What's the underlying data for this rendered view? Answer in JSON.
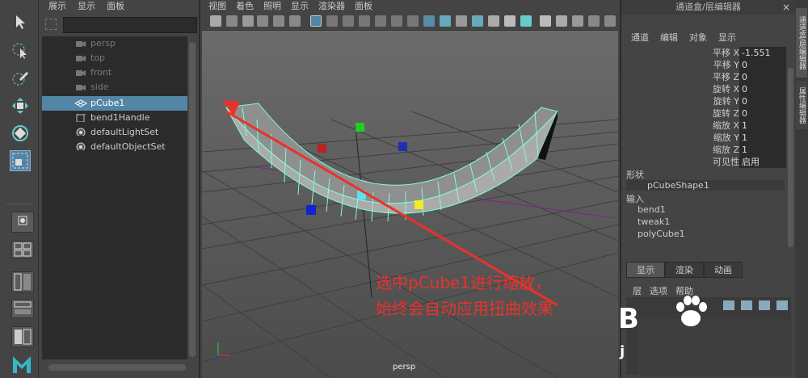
{
  "outliner": {
    "menu": [
      "展示",
      "显示",
      "面板"
    ],
    "search": {
      "value": ""
    },
    "items": [
      {
        "label": "persp",
        "kind": "camera",
        "state": "dim"
      },
      {
        "label": "top",
        "kind": "camera",
        "state": "dim"
      },
      {
        "label": "front",
        "kind": "camera",
        "state": "dim"
      },
      {
        "label": "side",
        "kind": "camera",
        "state": "dim"
      },
      {
        "label": "pCube1",
        "kind": "mesh",
        "state": "selected"
      },
      {
        "label": "bend1Handle",
        "kind": "handle",
        "state": "normal"
      },
      {
        "label": "defaultLightSet",
        "kind": "set",
        "state": "normal"
      },
      {
        "label": "defaultObjectSet",
        "kind": "set",
        "state": "normal"
      }
    ]
  },
  "viewport": {
    "menu": [
      "视图",
      "着色",
      "照明",
      "显示",
      "渲染器",
      "面板"
    ],
    "camera_label": "persp",
    "annotation": {
      "line1": "选中pCube1进行缩放，",
      "line2": "始终会自动应用扭曲效果"
    }
  },
  "channel_box": {
    "title": "通道盒/层编辑器",
    "close": "×",
    "menu": [
      "通道",
      "编辑",
      "对象",
      "显示"
    ],
    "attributes": [
      {
        "label": "平移 X",
        "value": "-1.551"
      },
      {
        "label": "平移 Y",
        "value": "0"
      },
      {
        "label": "平移 Z",
        "value": "0"
      },
      {
        "label": "旋转 X",
        "value": "0"
      },
      {
        "label": "旋转 Y",
        "value": "0"
      },
      {
        "label": "旋转 Z",
        "value": "0"
      },
      {
        "label": "缩放 X",
        "value": "1"
      },
      {
        "label": "缩放 Y",
        "value": "1"
      },
      {
        "label": "缩放 Z",
        "value": "1"
      },
      {
        "label": "可见性",
        "value": "启用"
      }
    ],
    "shape_header": "形状",
    "shape_name": "pCubeShape1",
    "inputs_header": "输入",
    "inputs": [
      "bend1",
      "tweak1",
      "polyCube1"
    ],
    "tabs": [
      "显示",
      "渲染",
      "动画"
    ],
    "layer_menu": [
      "层",
      "选项",
      "帮助"
    ]
  },
  "side_tabs": [
    "通道盒/层编辑器",
    "属性编辑器"
  ],
  "watermark": {
    "letters": "B",
    "j": "j"
  },
  "colors": {
    "selection": "#5285a6",
    "annotation": "#e8322b",
    "wireframe": "#7fffd4"
  }
}
